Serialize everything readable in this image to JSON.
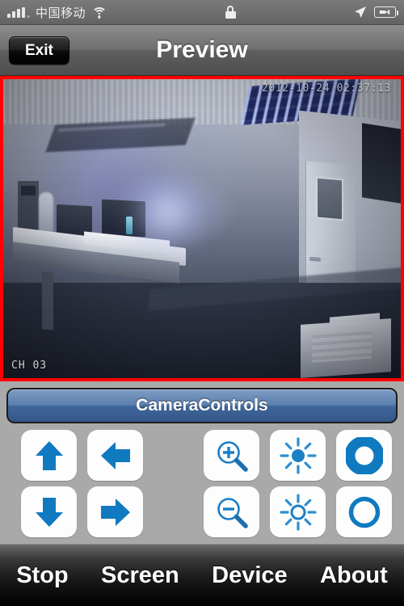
{
  "status_bar": {
    "signal_icon": "signal-bars-icon",
    "carrier": "中国移动",
    "wifi_icon": "wifi-icon",
    "lock_icon": "lock-icon",
    "location_icon": "location-arrow-icon",
    "battery_icon": "battery-charging-icon"
  },
  "nav_bar": {
    "back_label": "Exit",
    "title": "Preview"
  },
  "video": {
    "timestamp": "2012-10-24 02:37:13",
    "channel": "CH  03",
    "border_color": "#ff0000"
  },
  "controls": {
    "section_label": "CameraControls",
    "accent_color": "#0f7ac0",
    "buttons": [
      {
        "name": "pan-up-button",
        "icon": "arrow-up-icon"
      },
      {
        "name": "pan-left-button",
        "icon": "arrow-left-icon"
      },
      {
        "name": "pan-down-button",
        "icon": "arrow-down-icon"
      },
      {
        "name": "pan-right-button",
        "icon": "arrow-right-icon"
      },
      {
        "name": "zoom-in-button",
        "icon": "magnifier-plus-icon"
      },
      {
        "name": "zoom-out-button",
        "icon": "magnifier-minus-icon"
      },
      {
        "name": "brightness-up-button",
        "icon": "sun-filled-icon"
      },
      {
        "name": "brightness-down-button",
        "icon": "sun-outline-icon"
      },
      {
        "name": "focus-near-button",
        "icon": "ring-filled-icon"
      },
      {
        "name": "focus-far-button",
        "icon": "ring-outline-icon"
      }
    ]
  },
  "tab_bar": {
    "items": [
      {
        "label": "Stop"
      },
      {
        "label": "Screen"
      },
      {
        "label": "Device"
      },
      {
        "label": "About"
      }
    ]
  }
}
